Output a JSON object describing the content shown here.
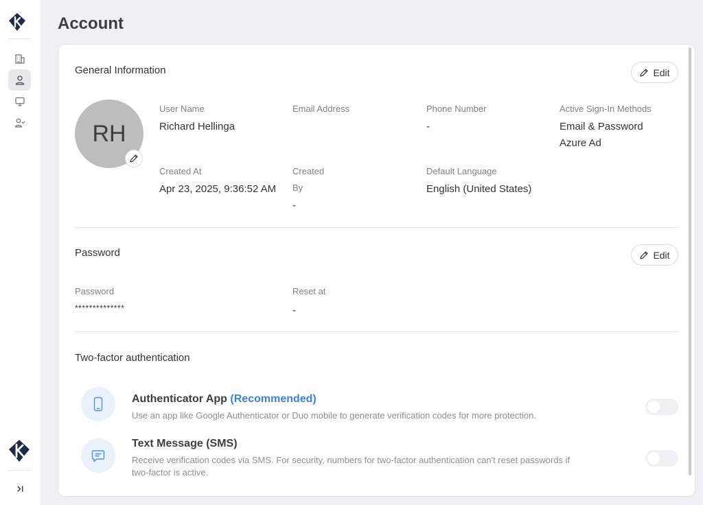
{
  "page": {
    "title": "Account"
  },
  "sidebar": {
    "items": [
      {
        "icon": "building-icon"
      },
      {
        "icon": "user-icon",
        "active": true
      },
      {
        "icon": "monitor-icon"
      },
      {
        "icon": "user-check-icon"
      }
    ],
    "collapse_label": ">|"
  },
  "general": {
    "title": "General Information",
    "edit_label": "Edit",
    "avatar_initials": "RH",
    "fields": {
      "user_name": {
        "label": "User Name",
        "value": "Richard Hellinga"
      },
      "email": {
        "label": "Email Address",
        "value": ""
      },
      "phone": {
        "label": "Phone Number",
        "value": "-"
      },
      "sign_in": {
        "label": "Active Sign-In Methods",
        "values": [
          "Email & Password",
          "Azure Ad"
        ]
      },
      "created_at": {
        "label": "Created At",
        "value": "Apr 23, 2025, 9:36:52 AM"
      },
      "created_by": {
        "label_line1": "Created",
        "label_line2": "By",
        "value": "-"
      },
      "language": {
        "label": "Default Language",
        "value": "English (United States)"
      }
    }
  },
  "password": {
    "title": "Password",
    "edit_label": "Edit",
    "password_label": "Password",
    "password_value": "**************",
    "reset_label": "Reset at",
    "reset_value": "-"
  },
  "two_factor": {
    "title": "Two-factor authentication",
    "methods": [
      {
        "title": "Authenticator App",
        "badge": "(Recommended)",
        "description": "Use an app like Google Authenticator or Duo mobile to generate verification codes for more protection.",
        "icon": "phone-icon",
        "enabled": false
      },
      {
        "title": "Text Message (SMS)",
        "description_line1": "Receive verification codes via SMS. For security, numbers for two-factor authentication can't reset passwords if",
        "description_line2": "two-factor is active.",
        "icon": "message-icon",
        "enabled": false
      }
    ]
  },
  "colors": {
    "accent": "#3b82d6",
    "logo": "#1e2a4a",
    "avatar_bg": "#bdbdbd"
  }
}
